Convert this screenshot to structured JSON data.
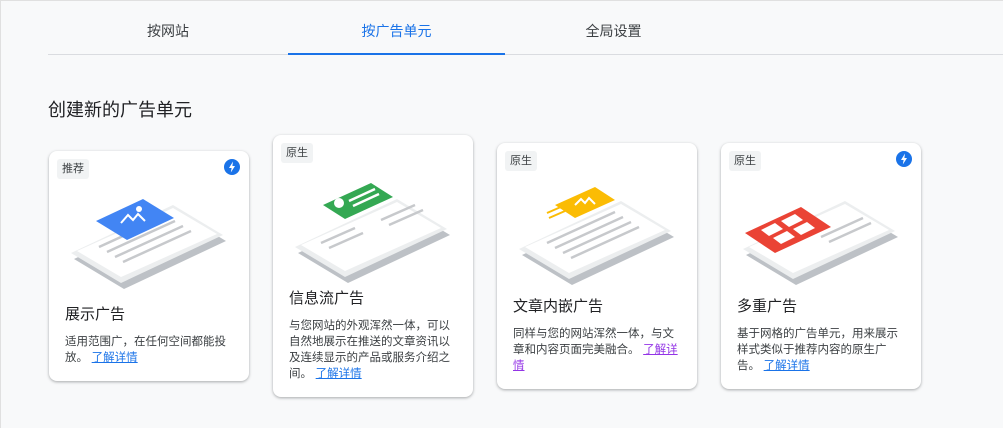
{
  "tabs": [
    {
      "label": "按网站",
      "active": false
    },
    {
      "label": "按广告单元",
      "active": true
    },
    {
      "label": "全局设置",
      "active": false
    }
  ],
  "section_title": "创建新的广告单元",
  "cards": [
    {
      "badge": "推荐",
      "title": "展示广告",
      "desc": "适用范围广，在任何空间都能投放。",
      "link": "了解详情",
      "bolt": true,
      "accent": "#4285f4"
    },
    {
      "badge": "原生",
      "title": "信息流广告",
      "desc": "与您网站的外观浑然一体，可以自然地展示在推送的文章资讯以及连续显示的产品或服务介绍之间。",
      "link": "了解详情",
      "bolt": false,
      "accent": "#34a853"
    },
    {
      "badge": "原生",
      "title": "文章内嵌广告",
      "desc": "同样与您的网站浑然一体，与文章和内容页面完美融合。",
      "link": "了解详情",
      "bolt": false,
      "accent": "#fbbc04"
    },
    {
      "badge": "原生",
      "title": "多重广告",
      "desc": "基于网格的广告单元，用来展示样式类似于推荐内容的原生广告。",
      "link": "了解详情",
      "bolt": true,
      "accent": "#ea4335"
    }
  ],
  "colors": {
    "primary": "#1a73e8",
    "visited_link": "#9334e6"
  }
}
